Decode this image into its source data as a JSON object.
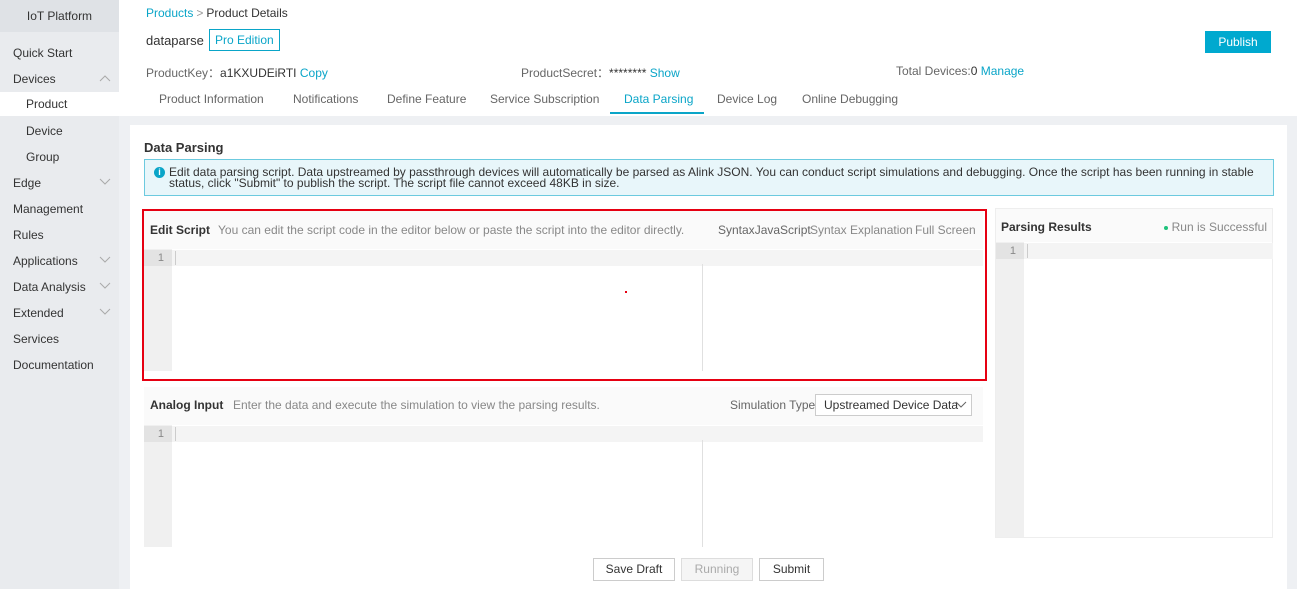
{
  "sidebar": {
    "title": "IoT Platform",
    "items": [
      {
        "label": "Quick Start"
      },
      {
        "label": "Devices"
      },
      {
        "label": "Product"
      },
      {
        "label": "Device"
      },
      {
        "label": "Group"
      },
      {
        "label": "Edge"
      },
      {
        "label": "Management"
      },
      {
        "label": "Rules"
      },
      {
        "label": "Applications"
      },
      {
        "label": "Data Analysis"
      },
      {
        "label": "Extended"
      },
      {
        "label": "Services"
      },
      {
        "label": "Documentation"
      }
    ]
  },
  "header": {
    "breadcrumb_root": "Products",
    "breadcrumb_sep": ">",
    "breadcrumb_current": "Product Details",
    "product_name": "dataparse",
    "edition_badge": "Pro Edition",
    "publish_label": "Publish",
    "product_key_label": "ProductKey：",
    "product_key_value": "a1KXUDEiRTI",
    "copy_label": "Copy",
    "product_secret_label": "ProductSecret：",
    "product_secret_value": "********",
    "show_label": "Show",
    "total_devices_label": "Total Devices:",
    "total_devices_value": "0",
    "manage_label": "Manage"
  },
  "tabs": [
    {
      "label": "Product Information"
    },
    {
      "label": "Notifications"
    },
    {
      "label": "Define Feature"
    },
    {
      "label": "Service Subscription"
    },
    {
      "label": "Data Parsing"
    },
    {
      "label": "Device Log"
    },
    {
      "label": "Online Debugging"
    }
  ],
  "main": {
    "section_title": "Data Parsing",
    "notice_text": "Edit data parsing script. Data upstreamed by passthrough devices will automatically be parsed as Alink JSON. You can conduct script simulations and debugging. Once the script has been running in stable status, click \"Submit\" to publish the script. The script file cannot exceed 48KB in size.",
    "edit_script": {
      "title": "Edit Script",
      "hint": "You can edit the script code in the editor below or paste the script into the editor directly.",
      "syntax_label": "Syntax",
      "syntax_value": "JavaScript",
      "syntax_explanation": "Syntax Explanation",
      "full_screen": "Full Screen",
      "line_number": "1"
    },
    "analog_input": {
      "title": "Analog Input",
      "hint": "Enter the data and execute the simulation to view the parsing results.",
      "simulation_type_label": "Simulation Type",
      "simulation_type_value": "Upstreamed Device Data",
      "line_number": "1"
    },
    "parsing_results": {
      "title": "Parsing Results",
      "status": "Run is Successful",
      "line_number": "1"
    },
    "buttons": {
      "save_draft": "Save Draft",
      "running": "Running",
      "submit": "Submit"
    }
  },
  "colors": {
    "accent": "#0aa5c8",
    "highlight_border": "#e60012",
    "success": "#1ec27c"
  }
}
